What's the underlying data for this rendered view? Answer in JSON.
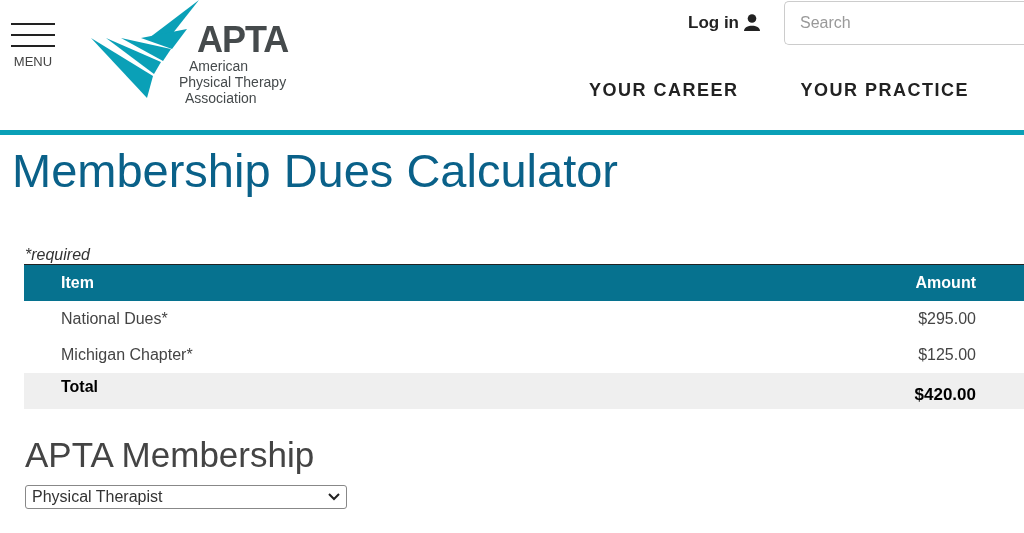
{
  "header": {
    "menu_label": "MENU",
    "logo": {
      "name": "APTA",
      "lines": [
        "American",
        "Physical Therapy",
        "Association"
      ]
    },
    "login": "Log in",
    "search": {
      "placeholder": "Search"
    },
    "nav": [
      "YOUR CAREER",
      "YOUR PRACTICE"
    ]
  },
  "title": "Membership Dues Calculator",
  "required_note": "*required",
  "table": {
    "columns": [
      "Item",
      "Amount"
    ],
    "rows": [
      {
        "kind": "item",
        "item": "National Dues*",
        "amount": "$295.00"
      },
      {
        "kind": "item",
        "item": "Michigan Chapter*",
        "amount": "$125.00"
      },
      {
        "kind": "total",
        "item": "Total",
        "amount": "$420.00"
      }
    ]
  },
  "membership": {
    "heading": "APTA Membership",
    "value": "Physical Therapist"
  }
}
